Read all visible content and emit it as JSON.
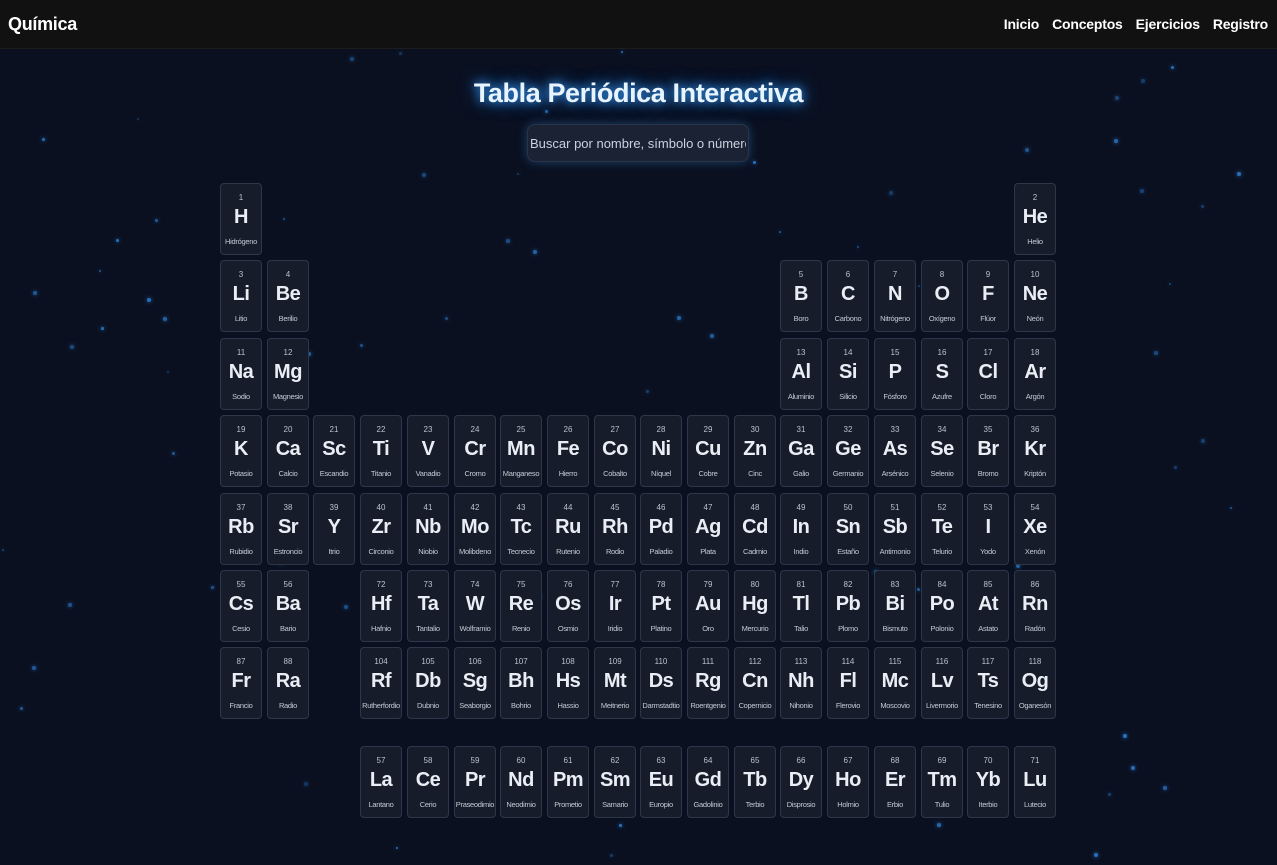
{
  "navbar": {
    "brand": "Química",
    "links": [
      "Inicio",
      "Conceptos",
      "Ejercicios",
      "Registro"
    ]
  },
  "title": "Tabla Periódica Interactiva",
  "search": {
    "placeholder": "Buscar por nombre, símbolo o número..."
  },
  "colors": {
    "background": "#0a1020",
    "navbar": "#111111",
    "tile": "#161c2a",
    "tile_border": "#2e3748",
    "glow": "#3a9ef7",
    "star": "#2b78c8"
  },
  "elements": [
    {
      "n": 1,
      "s": "H",
      "name": "Hidrógeno",
      "period": 1,
      "group": 1
    },
    {
      "n": 2,
      "s": "He",
      "name": "Helio",
      "period": 1,
      "group": 18
    },
    {
      "n": 3,
      "s": "Li",
      "name": "Litio",
      "period": 2,
      "group": 1
    },
    {
      "n": 4,
      "s": "Be",
      "name": "Berilio",
      "period": 2,
      "group": 2
    },
    {
      "n": 5,
      "s": "B",
      "name": "Boro",
      "period": 2,
      "group": 13
    },
    {
      "n": 6,
      "s": "C",
      "name": "Carbono",
      "period": 2,
      "group": 14
    },
    {
      "n": 7,
      "s": "N",
      "name": "Nitrógeno",
      "period": 2,
      "group": 15
    },
    {
      "n": 8,
      "s": "O",
      "name": "Oxígeno",
      "period": 2,
      "group": 16
    },
    {
      "n": 9,
      "s": "F",
      "name": "Flúor",
      "period": 2,
      "group": 17
    },
    {
      "n": 10,
      "s": "Ne",
      "name": "Neón",
      "period": 2,
      "group": 18
    },
    {
      "n": 11,
      "s": "Na",
      "name": "Sodio",
      "period": 3,
      "group": 1
    },
    {
      "n": 12,
      "s": "Mg",
      "name": "Magnesio",
      "period": 3,
      "group": 2
    },
    {
      "n": 13,
      "s": "Al",
      "name": "Aluminio",
      "period": 3,
      "group": 13
    },
    {
      "n": 14,
      "s": "Si",
      "name": "Silicio",
      "period": 3,
      "group": 14
    },
    {
      "n": 15,
      "s": "P",
      "name": "Fósforo",
      "period": 3,
      "group": 15
    },
    {
      "n": 16,
      "s": "S",
      "name": "Azufre",
      "period": 3,
      "group": 16
    },
    {
      "n": 17,
      "s": "Cl",
      "name": "Cloro",
      "period": 3,
      "group": 17
    },
    {
      "n": 18,
      "s": "Ar",
      "name": "Argón",
      "period": 3,
      "group": 18
    },
    {
      "n": 19,
      "s": "K",
      "name": "Potasio",
      "period": 4,
      "group": 1
    },
    {
      "n": 20,
      "s": "Ca",
      "name": "Calcio",
      "period": 4,
      "group": 2
    },
    {
      "n": 21,
      "s": "Sc",
      "name": "Escandio",
      "period": 4,
      "group": 3
    },
    {
      "n": 22,
      "s": "Ti",
      "name": "Titanio",
      "period": 4,
      "group": 4
    },
    {
      "n": 23,
      "s": "V",
      "name": "Vanadio",
      "period": 4,
      "group": 5
    },
    {
      "n": 24,
      "s": "Cr",
      "name": "Cromo",
      "period": 4,
      "group": 6
    },
    {
      "n": 25,
      "s": "Mn",
      "name": "Manganeso",
      "period": 4,
      "group": 7
    },
    {
      "n": 26,
      "s": "Fe",
      "name": "Hierro",
      "period": 4,
      "group": 8
    },
    {
      "n": 27,
      "s": "Co",
      "name": "Cobalto",
      "period": 4,
      "group": 9
    },
    {
      "n": 28,
      "s": "Ni",
      "name": "Níquel",
      "period": 4,
      "group": 10
    },
    {
      "n": 29,
      "s": "Cu",
      "name": "Cobre",
      "period": 4,
      "group": 11
    },
    {
      "n": 30,
      "s": "Zn",
      "name": "Cinc",
      "period": 4,
      "group": 12
    },
    {
      "n": 31,
      "s": "Ga",
      "name": "Galio",
      "period": 4,
      "group": 13
    },
    {
      "n": 32,
      "s": "Ge",
      "name": "Germanio",
      "period": 4,
      "group": 14
    },
    {
      "n": 33,
      "s": "As",
      "name": "Arsénico",
      "period": 4,
      "group": 15
    },
    {
      "n": 34,
      "s": "Se",
      "name": "Selenio",
      "period": 4,
      "group": 16
    },
    {
      "n": 35,
      "s": "Br",
      "name": "Bromo",
      "period": 4,
      "group": 17
    },
    {
      "n": 36,
      "s": "Kr",
      "name": "Kriptón",
      "period": 4,
      "group": 18
    },
    {
      "n": 37,
      "s": "Rb",
      "name": "Rubidio",
      "period": 5,
      "group": 1
    },
    {
      "n": 38,
      "s": "Sr",
      "name": "Estroncio",
      "period": 5,
      "group": 2
    },
    {
      "n": 39,
      "s": "Y",
      "name": "Itrio",
      "period": 5,
      "group": 3
    },
    {
      "n": 40,
      "s": "Zr",
      "name": "Circonio",
      "period": 5,
      "group": 4
    },
    {
      "n": 41,
      "s": "Nb",
      "name": "Niobio",
      "period": 5,
      "group": 5
    },
    {
      "n": 42,
      "s": "Mo",
      "name": "Molibdeno",
      "period": 5,
      "group": 6
    },
    {
      "n": 43,
      "s": "Tc",
      "name": "Tecnecio",
      "period": 5,
      "group": 7
    },
    {
      "n": 44,
      "s": "Ru",
      "name": "Rutenio",
      "period": 5,
      "group": 8
    },
    {
      "n": 45,
      "s": "Rh",
      "name": "Rodio",
      "period": 5,
      "group": 9
    },
    {
      "n": 46,
      "s": "Pd",
      "name": "Paladio",
      "period": 5,
      "group": 10
    },
    {
      "n": 47,
      "s": "Ag",
      "name": "Plata",
      "period": 5,
      "group": 11
    },
    {
      "n": 48,
      "s": "Cd",
      "name": "Cadmio",
      "period": 5,
      "group": 12
    },
    {
      "n": 49,
      "s": "In",
      "name": "Indio",
      "period": 5,
      "group": 13
    },
    {
      "n": 50,
      "s": "Sn",
      "name": "Estaño",
      "period": 5,
      "group": 14
    },
    {
      "n": 51,
      "s": "Sb",
      "name": "Antimonio",
      "period": 5,
      "group": 15
    },
    {
      "n": 52,
      "s": "Te",
      "name": "Telurio",
      "period": 5,
      "group": 16
    },
    {
      "n": 53,
      "s": "I",
      "name": "Yodo",
      "period": 5,
      "group": 17
    },
    {
      "n": 54,
      "s": "Xe",
      "name": "Xenón",
      "period": 5,
      "group": 18
    },
    {
      "n": 55,
      "s": "Cs",
      "name": "Cesio",
      "period": 6,
      "group": 1
    },
    {
      "n": 56,
      "s": "Ba",
      "name": "Bario",
      "period": 6,
      "group": 2
    },
    {
      "n": 72,
      "s": "Hf",
      "name": "Hafnio",
      "period": 6,
      "group": 4
    },
    {
      "n": 73,
      "s": "Ta",
      "name": "Tantalio",
      "period": 6,
      "group": 5
    },
    {
      "n": 74,
      "s": "W",
      "name": "Wolframio",
      "period": 6,
      "group": 6
    },
    {
      "n": 75,
      "s": "Re",
      "name": "Renio",
      "period": 6,
      "group": 7
    },
    {
      "n": 76,
      "s": "Os",
      "name": "Osmio",
      "period": 6,
      "group": 8
    },
    {
      "n": 77,
      "s": "Ir",
      "name": "Iridio",
      "period": 6,
      "group": 9
    },
    {
      "n": 78,
      "s": "Pt",
      "name": "Platino",
      "period": 6,
      "group": 10
    },
    {
      "n": 79,
      "s": "Au",
      "name": "Oro",
      "period": 6,
      "group": 11
    },
    {
      "n": 80,
      "s": "Hg",
      "name": "Mercurio",
      "period": 6,
      "group": 12
    },
    {
      "n": 81,
      "s": "Tl",
      "name": "Talio",
      "period": 6,
      "group": 13
    },
    {
      "n": 82,
      "s": "Pb",
      "name": "Plomo",
      "period": 6,
      "group": 14
    },
    {
      "n": 83,
      "s": "Bi",
      "name": "Bismuto",
      "period": 6,
      "group": 15
    },
    {
      "n": 84,
      "s": "Po",
      "name": "Polonio",
      "period": 6,
      "group": 16
    },
    {
      "n": 85,
      "s": "At",
      "name": "Astato",
      "period": 6,
      "group": 17
    },
    {
      "n": 86,
      "s": "Rn",
      "name": "Radón",
      "period": 6,
      "group": 18
    },
    {
      "n": 87,
      "s": "Fr",
      "name": "Francio",
      "period": 7,
      "group": 1
    },
    {
      "n": 88,
      "s": "Ra",
      "name": "Radio",
      "period": 7,
      "group": 2
    },
    {
      "n": 104,
      "s": "Rf",
      "name": "Rutherfordio",
      "period": 7,
      "group": 4
    },
    {
      "n": 105,
      "s": "Db",
      "name": "Dubnio",
      "period": 7,
      "group": 5
    },
    {
      "n": 106,
      "s": "Sg",
      "name": "Seaborgio",
      "period": 7,
      "group": 6
    },
    {
      "n": 107,
      "s": "Bh",
      "name": "Bohrio",
      "period": 7,
      "group": 7
    },
    {
      "n": 108,
      "s": "Hs",
      "name": "Hassio",
      "period": 7,
      "group": 8
    },
    {
      "n": 109,
      "s": "Mt",
      "name": "Meitnerio",
      "period": 7,
      "group": 9
    },
    {
      "n": 110,
      "s": "Ds",
      "name": "Darmstadtio",
      "period": 7,
      "group": 10
    },
    {
      "n": 111,
      "s": "Rg",
      "name": "Roentgenio",
      "period": 7,
      "group": 11
    },
    {
      "n": 112,
      "s": "Cn",
      "name": "Copernicio",
      "period": 7,
      "group": 12
    },
    {
      "n": 113,
      "s": "Nh",
      "name": "Nihonio",
      "period": 7,
      "group": 13
    },
    {
      "n": 114,
      "s": "Fl",
      "name": "Flerovio",
      "period": 7,
      "group": 14
    },
    {
      "n": 115,
      "s": "Mc",
      "name": "Moscovio",
      "period": 7,
      "group": 15
    },
    {
      "n": 116,
      "s": "Lv",
      "name": "Livermorio",
      "period": 7,
      "group": 16
    },
    {
      "n": 117,
      "s": "Ts",
      "name": "Tenesino",
      "period": 7,
      "group": 17
    },
    {
      "n": 118,
      "s": "Og",
      "name": "Oganesón",
      "period": 7,
      "group": 18
    }
  ],
  "lanthanides": [
    {
      "n": 57,
      "s": "La",
      "name": "Lantano"
    },
    {
      "n": 58,
      "s": "Ce",
      "name": "Cerio"
    },
    {
      "n": 59,
      "s": "Pr",
      "name": "Praseodimio"
    },
    {
      "n": 60,
      "s": "Nd",
      "name": "Neodimio"
    },
    {
      "n": 61,
      "s": "Pm",
      "name": "Prometio"
    },
    {
      "n": 62,
      "s": "Sm",
      "name": "Samario"
    },
    {
      "n": 63,
      "s": "Eu",
      "name": "Europio"
    },
    {
      "n": 64,
      "s": "Gd",
      "name": "Gadolinio"
    },
    {
      "n": 65,
      "s": "Tb",
      "name": "Terbio"
    },
    {
      "n": 66,
      "s": "Dy",
      "name": "Disprosio"
    },
    {
      "n": 67,
      "s": "Ho",
      "name": "Holmio"
    },
    {
      "n": 68,
      "s": "Er",
      "name": "Erbio"
    },
    {
      "n": 69,
      "s": "Tm",
      "name": "Tulio"
    },
    {
      "n": 70,
      "s": "Yb",
      "name": "Iterbio"
    },
    {
      "n": 71,
      "s": "Lu",
      "name": "Lutecio"
    }
  ]
}
